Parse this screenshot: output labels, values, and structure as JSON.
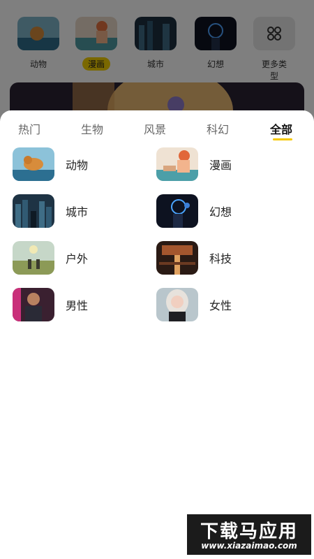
{
  "top_categories": [
    {
      "label": "动物",
      "active": false
    },
    {
      "label": "漫画",
      "active": true
    },
    {
      "label": "城市",
      "active": false
    },
    {
      "label": "幻想",
      "active": false
    },
    {
      "label": "更多类型",
      "active": false
    }
  ],
  "tabs": [
    {
      "label": "热门",
      "active": false
    },
    {
      "label": "生物",
      "active": false
    },
    {
      "label": "风景",
      "active": false
    },
    {
      "label": "科幻",
      "active": false
    },
    {
      "label": "全部",
      "active": true
    }
  ],
  "categories": [
    {
      "label": "动物"
    },
    {
      "label": "漫画"
    },
    {
      "label": "城市"
    },
    {
      "label": "幻想"
    },
    {
      "label": "户外"
    },
    {
      "label": "科技"
    },
    {
      "label": "男性"
    },
    {
      "label": "女性"
    }
  ],
  "watermark": {
    "title": "下载马应用",
    "url": "www.xiazaimao.com"
  },
  "colors": {
    "accent": "#f5c800",
    "overlay": "rgba(0,0,0,0.5)"
  }
}
